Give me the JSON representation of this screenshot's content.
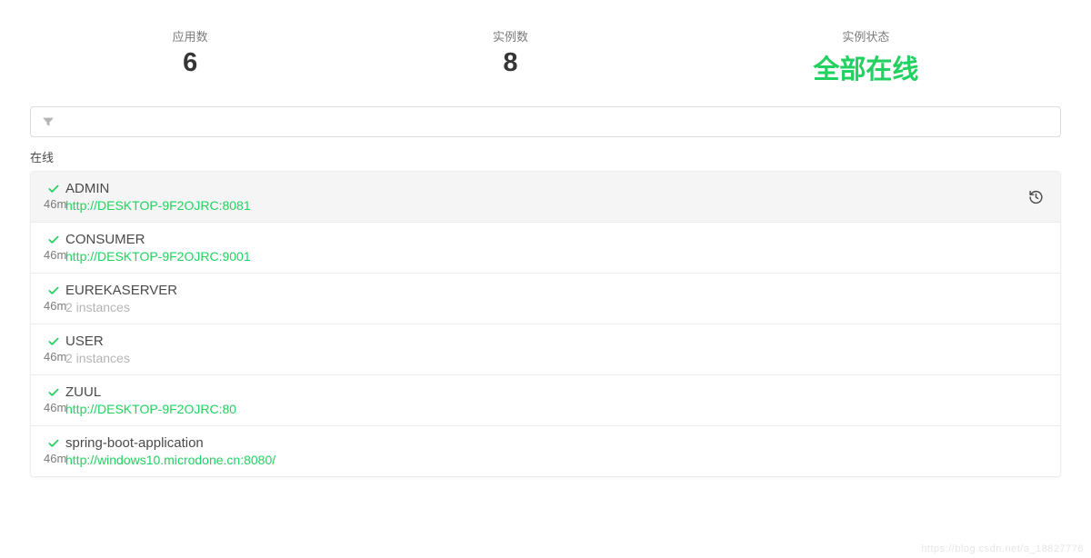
{
  "stats": {
    "apps_label": "应用数",
    "apps_value": "6",
    "instances_label": "实例数",
    "instances_value": "8",
    "status_label": "实例状态",
    "status_value": "全部在线"
  },
  "filter": {
    "placeholder": ""
  },
  "section_label": "在线",
  "apps": [
    {
      "time": "46m",
      "name": "ADMIN",
      "url": "http://DESKTOP-9F2OJRC:8081",
      "instances": "",
      "selected": true,
      "has_history": true
    },
    {
      "time": "46m",
      "name": "CONSUMER",
      "url": "http://DESKTOP-9F2OJRC:9001",
      "instances": "",
      "selected": false,
      "has_history": false
    },
    {
      "time": "46m",
      "name": "EUREKASERVER",
      "url": "",
      "instances": "2 instances",
      "selected": false,
      "has_history": false
    },
    {
      "time": "46m",
      "name": "USER",
      "url": "",
      "instances": "2 instances",
      "selected": false,
      "has_history": false
    },
    {
      "time": "46m",
      "name": "ZUUL",
      "url": "http://DESKTOP-9F2OJRC:80",
      "instances": "",
      "selected": false,
      "has_history": false
    },
    {
      "time": "46m",
      "name": "spring-boot-application",
      "url": "http://windows10.microdone.cn:8080/",
      "instances": "",
      "selected": false,
      "has_history": false
    }
  ],
  "watermark": "https://blog.csdn.net/a_18827776"
}
